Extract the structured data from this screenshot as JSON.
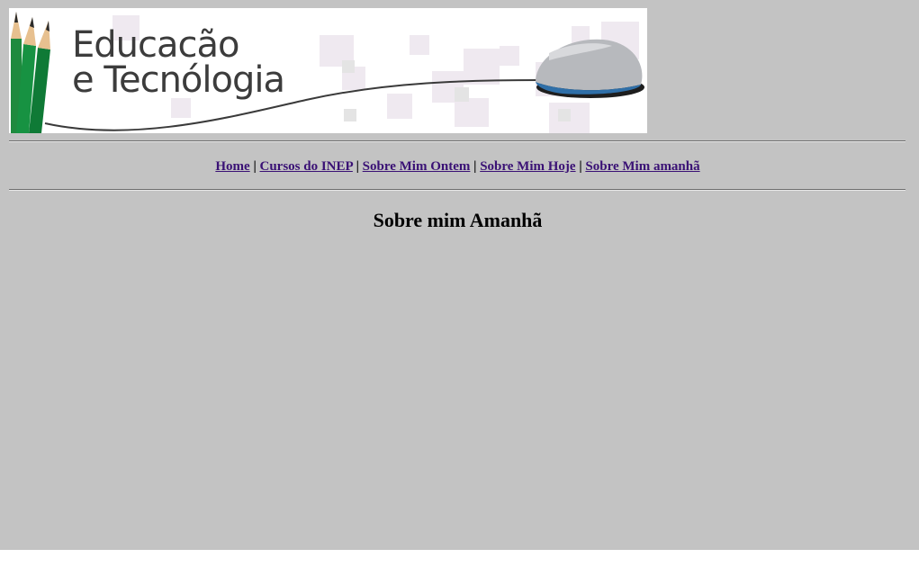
{
  "banner": {
    "title_line1": "Educacão",
    "title_line2": "e Tecnólogia"
  },
  "nav": {
    "items": [
      {
        "label": "Home"
      },
      {
        "label": "Cursos do INEP"
      },
      {
        "label": "Sobre Mim Ontem"
      },
      {
        "label": "Sobre Mim Hoje"
      },
      {
        "label": "Sobre Mim amanhã"
      }
    ],
    "separator": "|"
  },
  "page": {
    "title": "Sobre mim Amanhã"
  },
  "colors": {
    "background": "#c3c3c3",
    "link": "#3a1175",
    "pencil_green": "#1f8a3e",
    "mouse_blue": "#2f6fa8"
  },
  "icons": [
    "pencil-icon",
    "computer-mouse-icon"
  ]
}
